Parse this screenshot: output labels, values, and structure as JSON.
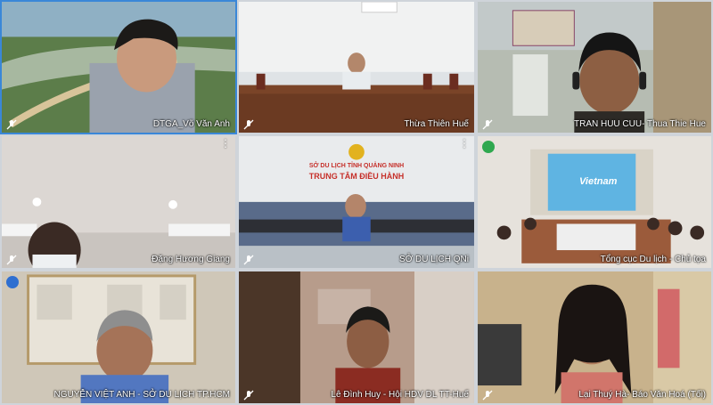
{
  "tiles": [
    {
      "name": "DTGA_Võ Văn Anh",
      "muted": true,
      "active": true
    },
    {
      "name": "Thừa Thiên Huế",
      "muted": true
    },
    {
      "name": "TRAN HUU CUU- Thua Thie Hue",
      "muted": true
    },
    {
      "name": "Đặng Hương Giang",
      "muted": true
    },
    {
      "name": "SỞ DU LỊCH QNi",
      "muted": true
    },
    {
      "name": "Tổng cục Du lịch - Chủ tọa",
      "muted": false
    },
    {
      "name": "NGUYỄN VIỆT ANH - SỞ DU LỊCH TP.HCM",
      "muted": false
    },
    {
      "name": "Lê Đình Huy - Hội HDV DL TT-Huế",
      "muted": true
    },
    {
      "name": "Lại Thuý Hà- Báo Văn Hoá (Tối)",
      "muted": true
    }
  ],
  "signs": {
    "line1": "SỞ DU LỊCH TỈNH QUẢNG NINH",
    "line2": "TRUNG TÂM ĐIỀU HÀNH"
  },
  "banner": "Vietnam",
  "colors": {
    "active_border": "#3a87d8",
    "speaking": "#2fa84f",
    "hand": "#2f6fd0"
  }
}
